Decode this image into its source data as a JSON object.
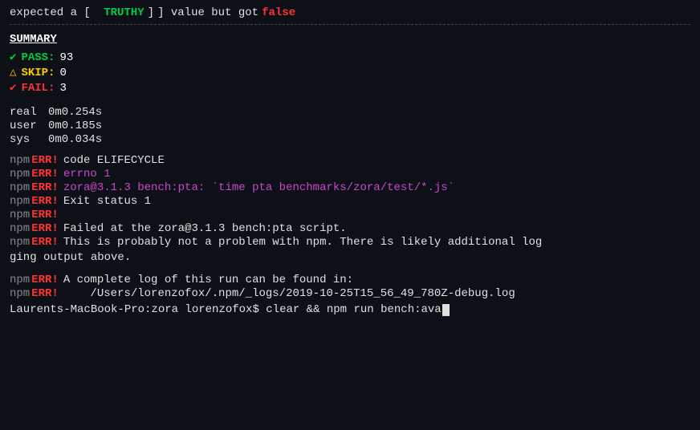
{
  "terminal": {
    "top_line": {
      "prefix": "expected a [",
      "truthy": " TRUTHY ",
      "middle": "] value but got",
      "false_val": "false"
    },
    "summary": {
      "title": "SUMMARY",
      "pass_icon": "✔",
      "pass_label": "PASS:",
      "pass_value": "93",
      "skip_icon": "△",
      "skip_label": "SKIP:",
      "skip_value": "0",
      "fail_icon": "✔",
      "fail_label": "FAIL:",
      "fail_value": "3"
    },
    "timing": [
      {
        "label": "real",
        "value": "0m0.254s"
      },
      {
        "label": "user",
        "value": "0m0.185s"
      },
      {
        "label": "sys",
        "value": "0m0.034s"
      }
    ],
    "npm_lines": [
      {
        "npm": "npm",
        "err": "ERR!",
        "content": "code ELIFECYCLE",
        "style": "white"
      },
      {
        "npm": "npm",
        "err": "ERR!",
        "content": "errno 1",
        "style": "magenta"
      },
      {
        "npm": "npm",
        "err": "ERR!",
        "content": "zora@3.1.3 bench:pta: `time pta benchmarks/zora/test/*.js`",
        "style": "magenta"
      },
      {
        "npm": "npm",
        "err": "ERR!",
        "content": "Exit status 1",
        "style": "white"
      },
      {
        "npm": "npm",
        "err": "ERR!",
        "content": "",
        "style": "white"
      },
      {
        "npm": "npm",
        "err": "ERR!",
        "content": "Failed at the zora@3.1.3 bench:pta script.",
        "style": "white"
      },
      {
        "npm": "npm",
        "err": "ERR!",
        "content": "This is probably not a problem with npm. There is likely additional log",
        "style": "white"
      }
    ],
    "wrap_line": "ging output above.",
    "blank_line": "",
    "npm_lines2": [
      {
        "npm": "npm",
        "err": "ERR!",
        "content": "A complete log of this run can be found in:",
        "style": "white"
      },
      {
        "npm": "npm",
        "err": "ERR!",
        "content": "    /Users/lorenzofox/.npm/_logs/2019-10-25T15_56_49_780Z-debug.log",
        "style": "white"
      }
    ],
    "prompt": {
      "machine": "Laurents-MacBook-Pro:zora",
      "user": "lorenzofox$",
      "command": " clear && npm run bench:ava"
    }
  }
}
